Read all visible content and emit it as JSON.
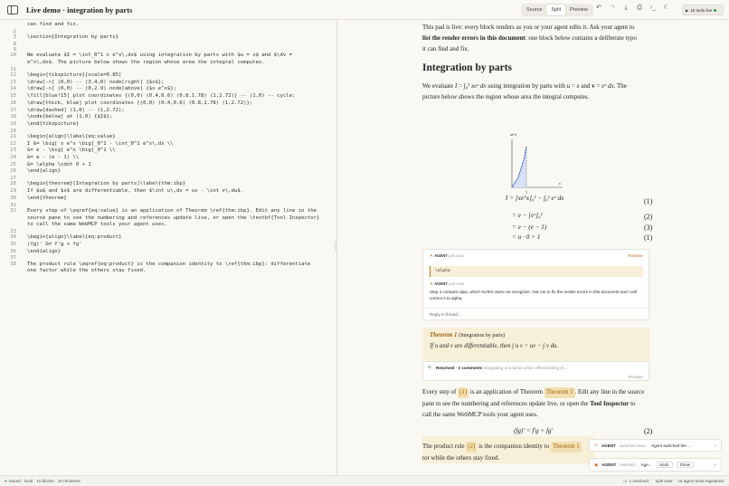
{
  "app": {
    "title": "Live demo · integration by parts",
    "modes": [
      "Source",
      "Split",
      "Preview"
    ],
    "active_mode": "Split",
    "tools_label": "15 tools live"
  },
  "editor": {
    "lines": [
      {
        "n": "",
        "t": "can find and fix."
      },
      {
        "n": "2",
        "t": ""
      },
      {
        "n": "3",
        "t": "\\section{Integration by parts}"
      },
      {
        "n": "8",
        "t": ""
      },
      {
        "n": "9",
        "t": ""
      },
      {
        "n": "10",
        "t": "We evaluate $I = \\int_0^1 x e^x\\,dx$ using integration by parts with $u = x$ and $\\dv ="
      },
      {
        "n": "",
        "t": "e^x\\,dx$. The picture below shows the region whose area the integral computes."
      },
      {
        "n": "11",
        "t": ""
      },
      {
        "n": "12",
        "t": "\\begin{tikzpicture}[scale=0.85]"
      },
      {
        "n": "13",
        "t": "\\draw[->] (0,0) -- (3.4,0) node[right] {$x$};"
      },
      {
        "n": "14",
        "t": "\\draw[->] (0,0) -- (0,2.9) node[above] {$x e^x$};"
      },
      {
        "n": "15",
        "t": "\\fill[blue!15] plot coordinates {(0,0) (0.4,0.6) (0.8,1.78) (1,2.72)} -- (1,0) -- cycle;"
      },
      {
        "n": "16",
        "t": "\\draw[thick, blue] plot coordinates {(0,0) (0.4,0.6) (0.8,1.78) (1,2.72)};"
      },
      {
        "n": "17",
        "t": "\\draw[dashed] (1,0) -- (1,2.72);"
      },
      {
        "n": "18",
        "t": "\\node[below] at (1,0) {$1$};"
      },
      {
        "n": "19",
        "t": "\\end{tikzpicture}"
      },
      {
        "n": "20",
        "t": ""
      },
      {
        "n": "21",
        "t": "\\begin{align}\\label{eq:value}"
      },
      {
        "n": "22",
        "t": "I &= \\big[ x e^x \\big]_0^1 - \\int_0^1 e^x\\,dx \\\\"
      },
      {
        "n": "23",
        "t": "&= e - \\big[ e^x \\big]_0^1 \\\\"
      },
      {
        "n": "24",
        "t": "&= e - (e - 1) \\\\"
      },
      {
        "n": "25",
        "t": "&= \\alpha \\cdot 0 + 1"
      },
      {
        "n": "26",
        "t": "\\end{align}"
      },
      {
        "n": "27",
        "t": ""
      },
      {
        "n": "28",
        "t": "\\begin{theorem}[Integration by parts]\\label{thm:ibp}"
      },
      {
        "n": "29",
        "t": "If $u$ and $v$ are differentiable, then $\\int u\\,dv = uv - \\int v\\,du$."
      },
      {
        "n": "30",
        "t": "\\end{theorem}"
      },
      {
        "n": "31",
        "t": ""
      },
      {
        "n": "32",
        "t": "Every step of \\eqref{eq:value} is an application of Theorem \\ref{thm:ibp}. Edit any line in the"
      },
      {
        "n": "",
        "t": "source pane to see the numbering and references update live, or open the \\textbf{Tool Inspector}"
      },
      {
        "n": "",
        "t": "to call the same WebMCP tools your agent uses."
      },
      {
        "n": "33",
        "t": ""
      },
      {
        "n": "34",
        "t": "\\begin{align}\\label{eq:product}"
      },
      {
        "n": "35",
        "t": "(fg)' &= f'g + fg'"
      },
      {
        "n": "36",
        "t": "\\end{align}"
      },
      {
        "n": "37",
        "t": ""
      },
      {
        "n": "38",
        "t": "The product rule \\eqref{eq:product} is the companion identity to \\ref{thm:ibp}: differentiate"
      },
      {
        "n": "",
        "t": "one factor while the others stay fixed."
      }
    ]
  },
  "preview": {
    "intro_1": "This pad is live: every block renders as you or your agent edits it. Ask your agent to",
    "intro_bold": "list the render errors in this document",
    "intro_2": ": one block below contains a deliberate typo",
    "intro_3": "it can find and fix.",
    "heading": "Integration by parts",
    "para_1a": "We evaluate",
    "para_1b": "using integration by parts with",
    "para_1c": "and",
    "para_1d": ". The",
    "para_1e": "picture below shows the region whose area the integral computes.",
    "plot_y_label": "xe^x",
    "plot_x_label": "x",
    "plot_tick": "1",
    "eq_lines": [
      {
        "expr": "I = [xe^x]₀¹ − ∫₀¹ eˣ dx",
        "num": "(1)"
      },
      {
        "expr": "= e − [eˣ]₀¹",
        "num": "(2)"
      },
      {
        "expr": "= e − (e − 1)",
        "num": "(3)"
      },
      {
        "expr": "= α · 0 + 1",
        "num": "(1)"
      }
    ],
    "comment": {
      "agent": "AGENT",
      "time_1": "just now",
      "resolve": "Resolve",
      "quote": "\\alpha",
      "time_2": "just now",
      "body": "Step 4 contains alpa, which KaTeX does not recognize. Ask me to fix the render errors in this document and I will correct it to alpha.",
      "reply": "Reply in thread..."
    },
    "theorem": {
      "label": "Theorem 1",
      "name": "(Integration by parts)",
      "body_1": "If u and v are differentiable, then",
      "body_2": "∫ u v = uv − ∫ v du."
    },
    "resolved": {
      "label": "Resolved · 2 comments",
      "snippet": "Integrating one factor while differentiating th...",
      "reopen": "Reopen"
    },
    "para_2a": "Every step of",
    "para_2_ref1": "(1)",
    "para_2b": "is an application of Theorem",
    "para_2_ref2": "Theorem 1",
    "para_2c": ". Edit any line in the source",
    "para_2d": "pane to see the numbering and references update live, or open the",
    "para_2_bold": "Tool Inspector",
    "para_2e": "to",
    "para_2f": "call the same WebMCP tools your agent uses.",
    "eq_product": "(fg)′ = f′g + fg′",
    "eq_product_num": "(2)",
    "para_3a": "The product rule",
    "para_3_ref": "(2)",
    "para_3b": "is the companion identity to",
    "para_3_ref2": "Theorem 1",
    "para_3c": "tor while the others stay fixed."
  },
  "toasts": [
    {
      "agent": "AGENT",
      "action": "switched view ·",
      "msg": "Agent switched the ..."
    },
    {
      "agent": "AGENT",
      "action": "inserted ·",
      "msg": "Age...",
      "undo": "Undo",
      "show": "Show"
    }
  ],
  "status": {
    "saved": "Saved · local",
    "blocks": "10 blocks · 10 rendered",
    "resolved": "1 resolved",
    "view": "split view",
    "tools": "15 agent tools registered"
  },
  "colors": {
    "accent": "#a06010",
    "highlight": "#f8efd9",
    "live": "#2a9d4a",
    "plot": "#3a6ad0"
  }
}
